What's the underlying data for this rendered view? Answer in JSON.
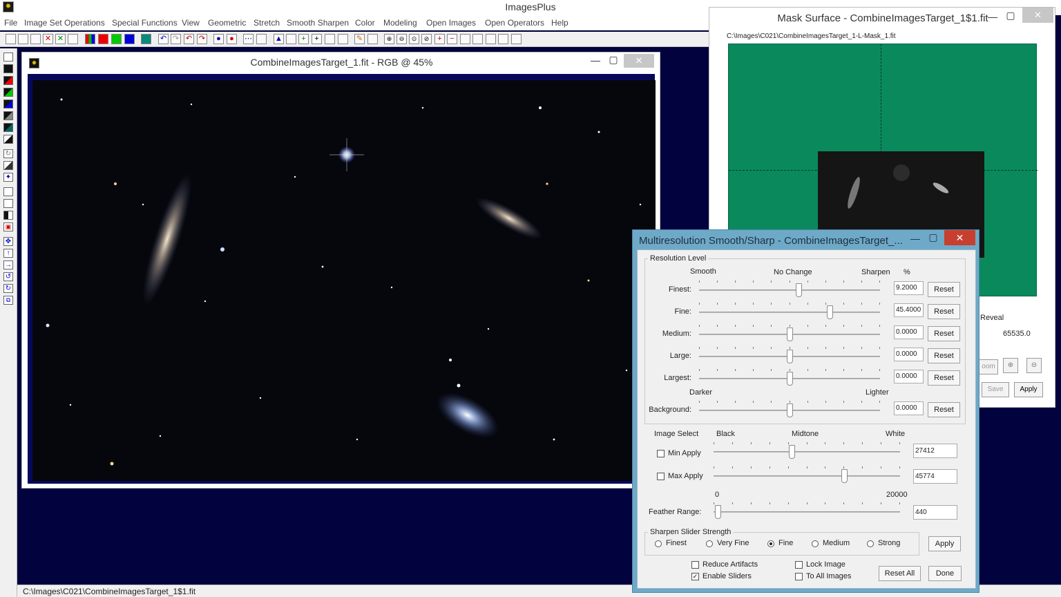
{
  "app": {
    "title": "ImagesPlus",
    "icon": "app-icon"
  },
  "menu": [
    "File",
    "Image Set Operations",
    "Special Functions",
    "View",
    "Geometric",
    "Stretch",
    "Smooth Sharpen",
    "Color",
    "Modeling",
    "Open Images",
    "Open Operators",
    "Help"
  ],
  "status": {
    "path": "C:\\Images\\C021\\CombineImagesTarget_1$1.fit"
  },
  "image_window": {
    "title": "CombineImagesTarget_1.fit - RGB @ 45%"
  },
  "mask_window": {
    "title": "Mask Surface - CombineImagesTarget_1$1.fit",
    "path": "C:\\Images\\C021\\CombineImagesTarget_1-L-Mask_1.fit",
    "reveal_label": "Reveal",
    "max_value": "65535.0",
    "zoom_label": "oom",
    "save_label": "Save",
    "apply_label": "Apply"
  },
  "multires": {
    "title": "Multiresolution Smooth/Sharp - CombineImagesTarget_...",
    "resolution_group": "Resolution Level",
    "header": {
      "smooth": "Smooth",
      "no_change": "No Change",
      "sharpen": "Sharpen",
      "percent": "%"
    },
    "levels": [
      {
        "label": "Finest:",
        "value": "9.2000",
        "pos": 0.55
      },
      {
        "label": "Fine:",
        "value": "45.4000",
        "pos": 0.72
      },
      {
        "label": "Medium:",
        "value": "0.0000",
        "pos": 0.5
      },
      {
        "label": "Large:",
        "value": "0.0000",
        "pos": 0.5
      },
      {
        "label": "Largest:",
        "value": "0.0000",
        "pos": 0.5
      }
    ],
    "bg_header": {
      "darker": "Darker",
      "lighter": "Lighter"
    },
    "background": {
      "label": "Background:",
      "value": "0.0000",
      "pos": 0.5
    },
    "reset_label": "Reset",
    "image_select": {
      "label": "Image Select",
      "black": "Black",
      "midtone": "Midtone",
      "white": "White",
      "min_apply": {
        "label": "Min Apply",
        "value": "27412",
        "checked": false,
        "pos": 0.42
      },
      "max_apply": {
        "label": "Max Apply",
        "value": "45774",
        "checked": false,
        "pos": 0.7
      }
    },
    "feather": {
      "label": "Feather Range:",
      "min": "0",
      "max": "20000",
      "value": "440",
      "pos": 0.022
    },
    "sharpen_strength": {
      "label": "Sharpen Slider Strength",
      "options": [
        "Finest",
        "Very Fine",
        "Fine",
        "Medium",
        "Strong"
      ],
      "selected": "Fine",
      "apply_label": "Apply"
    },
    "options": {
      "reduce_artifacts": {
        "label": "Reduce Artifacts",
        "checked": false
      },
      "enable_sliders": {
        "label": "Enable Sliders",
        "checked": true
      },
      "lock_image": {
        "label": "Lock Image",
        "checked": false
      },
      "to_all_images": {
        "label": "To All Images",
        "checked": false
      }
    },
    "reset_all_label": "Reset All",
    "done_label": "Done"
  }
}
